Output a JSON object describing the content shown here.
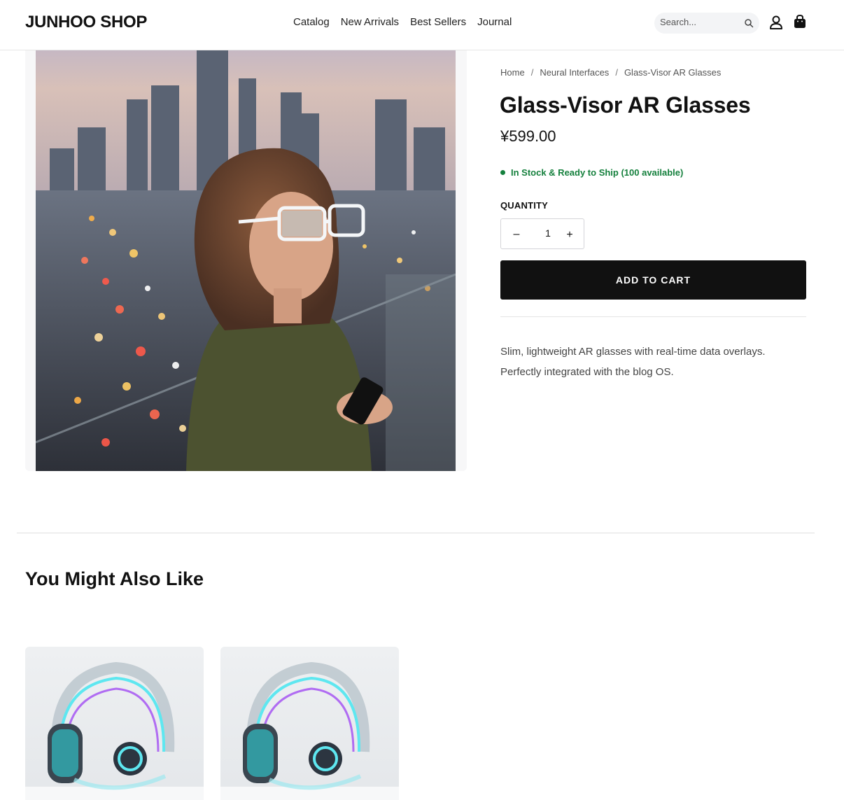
{
  "header": {
    "logo": "JUNHOO SHOP",
    "nav": [
      "Catalog",
      "New Arrivals",
      "Best Sellers",
      "Journal"
    ],
    "search_placeholder": "Search..."
  },
  "breadcrumb": [
    "Home",
    "Neural Interfaces",
    "Glass-Visor AR Glasses"
  ],
  "product": {
    "title": "Glass-Visor AR Glasses",
    "price": "¥599.00",
    "stock": "In Stock & Ready to Ship (100 available)",
    "quantity_label": "QUANTITY",
    "quantity": "1",
    "minus": "–",
    "plus": "+",
    "add_to_cart": "ADD TO CART",
    "description": "Slim, lightweight AR glasses with real-time data overlays. Perfectly integrated with the blog OS."
  },
  "related": {
    "title": "You Might Also Like"
  },
  "colors": {
    "accent": "#111111",
    "stock_green": "#15803d"
  }
}
